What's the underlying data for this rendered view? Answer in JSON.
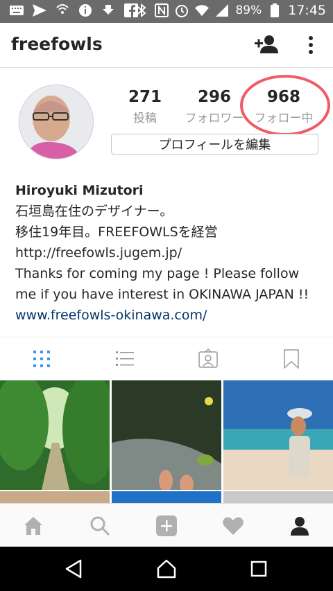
{
  "status_bar": {
    "battery": "89%",
    "time": "17:45"
  },
  "app_bar": {
    "title": "freefowls",
    "icons": [
      "add-user-icon",
      "more-vert-icon"
    ]
  },
  "profile": {
    "stats": [
      {
        "num": "271",
        "label": "投稿"
      },
      {
        "num": "296",
        "label": "フォロワー"
      },
      {
        "num": "968",
        "label": "フォロー中"
      }
    ],
    "edit_button": "プロフィールを編集",
    "bio": {
      "name": "Hiroyuki Mizutori",
      "lines": [
        "石垣島在住のデザイナー。",
        "移住19年目。FREEFOWLSを経営",
        "http://freefowls.jugem.jp/",
        "Thanks for coming my page ! Please follow",
        "me if you have interest in OKINAWA JAPAN !!"
      ],
      "link": "www.freefowls-okinawa.com/"
    }
  },
  "tabs": [
    "grid-icon",
    "list-icon",
    "tagged-icon",
    "bookmark-icon"
  ],
  "colors": {
    "accent_blue": "#3897f0",
    "highlight_circle": "#ef5a64",
    "link": "#003569"
  }
}
